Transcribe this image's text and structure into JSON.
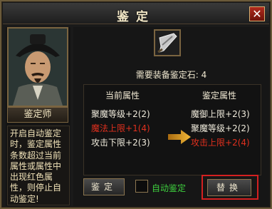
{
  "window": {
    "title": "鉴定",
    "close_label": "✕"
  },
  "npc": {
    "name": "鉴定师",
    "description": "开启自动鉴定时，鉴定属性条数超过当前属性或属性中出现红色属性，则停止自动鉴定!"
  },
  "appraisal": {
    "stone_label": "需要装备鉴定石:",
    "stone_count": "4",
    "current_header": "当前属性",
    "new_header": "鉴定属性",
    "current_attrs": [
      {
        "name": "聚魔等级",
        "value": "+2(2)",
        "color": "white"
      },
      {
        "name": "魔法上限",
        "value": "+1(4)",
        "color": "red"
      },
      {
        "name": "攻击下限",
        "value": "+2(3)",
        "color": "white"
      }
    ],
    "new_attrs": [
      {
        "name": "魔御上限",
        "value": "+2(3)",
        "color": "white"
      },
      {
        "name": "聚魔等级",
        "value": "+2(2)",
        "color": "white"
      },
      {
        "name": "攻击上限",
        "value": "+2(4)",
        "color": "red"
      }
    ]
  },
  "controls": {
    "appraise_button": "鉴定",
    "auto_label": "自动鉴定",
    "replace_button": "替换"
  },
  "colors": {
    "accent_red": "#e0301e",
    "auto_green": "#3ecf3e",
    "frame_gold": "#7a6440",
    "highlight_red": "#d42020"
  },
  "icons": {
    "item": "sword-blade-icon",
    "arrow": "right-arrow-icon"
  }
}
